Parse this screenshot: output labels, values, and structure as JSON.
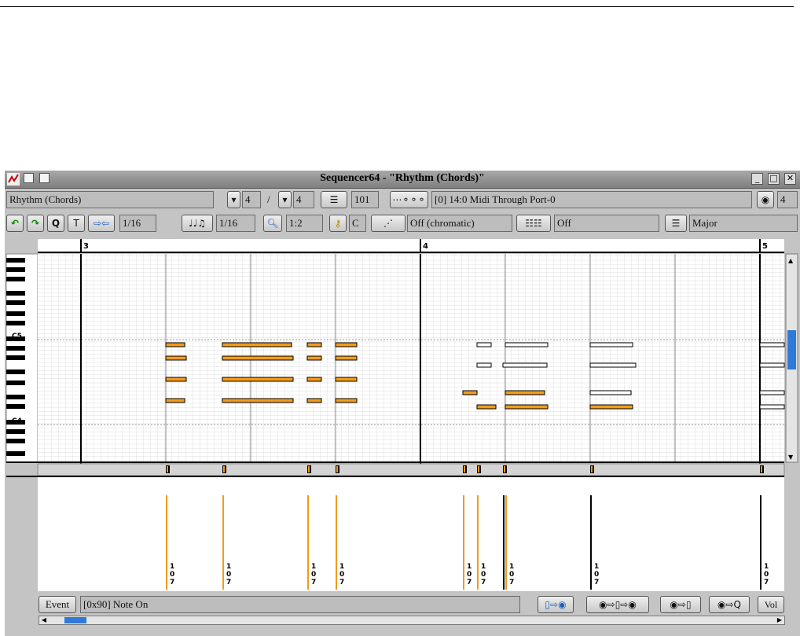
{
  "window": {
    "title": "Sequencer64 - \"Rhythm (Chords)\""
  },
  "toolbar1": {
    "sequence_name": "Rhythm (Chords)",
    "beats_per_measure": "4",
    "separator": "/",
    "beat_width": "4",
    "bpm": "101",
    "midi_bus": "[0] 14:0 Midi Through Port-0",
    "midi_channel": "4"
  },
  "toolbar2": {
    "snap": "1/16",
    "note_length": "1/16",
    "zoom": "1:2",
    "key_button": "Q",
    "music_key": "C",
    "scale_chromatic": "Off (chromatic)",
    "background_seq": "Off",
    "scale": "Major"
  },
  "timeline": {
    "bar_3": "3",
    "bar_4": "4",
    "bar_5": "5"
  },
  "piano": {
    "c5_label": "C5",
    "c4_label": "C4"
  },
  "velocity_labels": [
    "1",
    "0",
    "7"
  ],
  "bottombar": {
    "event_button": "Event",
    "event_value": "[0x90] Note On",
    "vol_button": "Vol"
  },
  "icons": {
    "undo": "undo-icon",
    "redo": "redo-icon",
    "quantize": "quantize-icon",
    "tools": "hammer-icon",
    "expand": "expand-contract-icon",
    "rhythm": "note-length-icon",
    "zoom": "magnifier-icon",
    "key": "key-icon",
    "scale": "scale-stairs-icon",
    "bus": "midi-port-icon",
    "midi_in": "midi-connector-icon",
    "bgseq": "background-sequence-icon",
    "chord": "chord-icon"
  },
  "colors": {
    "note_fill": "#f29b1c",
    "note_selected_fill": "#ffffff",
    "window_bg": "#c4c4c4",
    "title_bar": "#8f8f8f"
  }
}
